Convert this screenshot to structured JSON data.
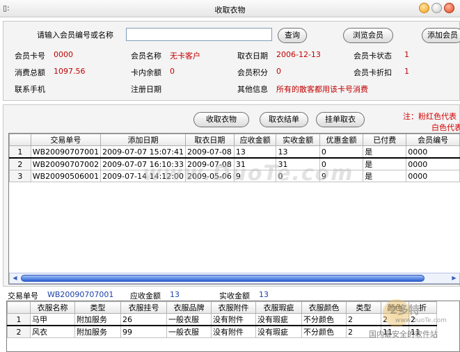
{
  "window": {
    "title": "收取衣物",
    "app_icon": "window-icon"
  },
  "search": {
    "label": "请输入会员编号或名称",
    "value": "",
    "placeholder": ""
  },
  "buttons": {
    "query": "查询",
    "browse": "浏览会员",
    "add": "添加会员"
  },
  "member": {
    "card_no_label": "会员卡号",
    "card_no": "0000",
    "name_label": "会员名称",
    "name": "无卡客户",
    "pickup_date_label": "取衣日期",
    "pickup_date": "2006-12-13",
    "card_status_label": "会员卡状态",
    "card_status": "1",
    "total_label": "消费总额",
    "total": "1097.56",
    "balance_label": "卡内余额",
    "balance": "0",
    "points_label": "会员积分",
    "points": "0",
    "discount_label": "会员卡折扣",
    "discount": "1",
    "phone_label": "联系手机",
    "reg_date_label": "注册日期",
    "other_label": "其他信息",
    "other": "所有的散客都用该卡号消费"
  },
  "actions": {
    "collect": "收取衣物",
    "settle": "取衣结单",
    "hold": "挂单取衣"
  },
  "note": {
    "line1": "注：粉红色代表",
    "line2": "白色代表"
  },
  "orders": {
    "headers": [
      "",
      "交易单号",
      "添加日期",
      "取衣日期",
      "应收金额",
      "实收金额",
      "优惠金额",
      "已付费",
      "会员编号"
    ],
    "rows": [
      [
        "1",
        "WB20090707001",
        "2009-07-07 15:07:41",
        "2009-07-08",
        "13",
        "13",
        "0",
        "是",
        "0000"
      ],
      [
        "2",
        "WB20090707002",
        "2009-07-07 16:10:33",
        "2009-07-08",
        "31",
        "31",
        "0",
        "是",
        "0000"
      ],
      [
        "3",
        "WB20090506001",
        "2009-07-14 14:12:00",
        "2009-05-06",
        "9",
        "0",
        "9",
        "是",
        "0000"
      ]
    ]
  },
  "summary": {
    "order_no_label": "交易单号",
    "order_no": "WB20090707001",
    "receivable_label": "应收金额",
    "receivable": "13",
    "received_label": "实收金额",
    "received": "13"
  },
  "items": {
    "headers": [
      "",
      "衣服名称",
      "类型",
      "衣服挂号",
      "衣服品牌",
      "衣服附件",
      "衣服瑕疵",
      "衣服颜色",
      "类型",
      "颜色",
      "折"
    ],
    "rows": [
      [
        "1",
        "马甲",
        "附加服务",
        "26",
        "一般衣服",
        "没有附件",
        "没有瑕疵",
        "不分颜色",
        "2",
        "2",
        "2"
      ],
      [
        "2",
        "风衣",
        "附加服务",
        "99",
        "一般衣服",
        "没有附件",
        "没有瑕疵",
        "不分颜色",
        "2",
        "11",
        "11"
      ]
    ]
  },
  "watermark": {
    "site": "www.DuoTe.com",
    "logo": "2多特",
    "logo_url": "www.DuoTe.com",
    "slogan": "国内最安全的软件站"
  },
  "colors": {
    "accent_red": "#c00000",
    "accent_blue": "#1a3fa8",
    "note_red": "#d40000"
  }
}
